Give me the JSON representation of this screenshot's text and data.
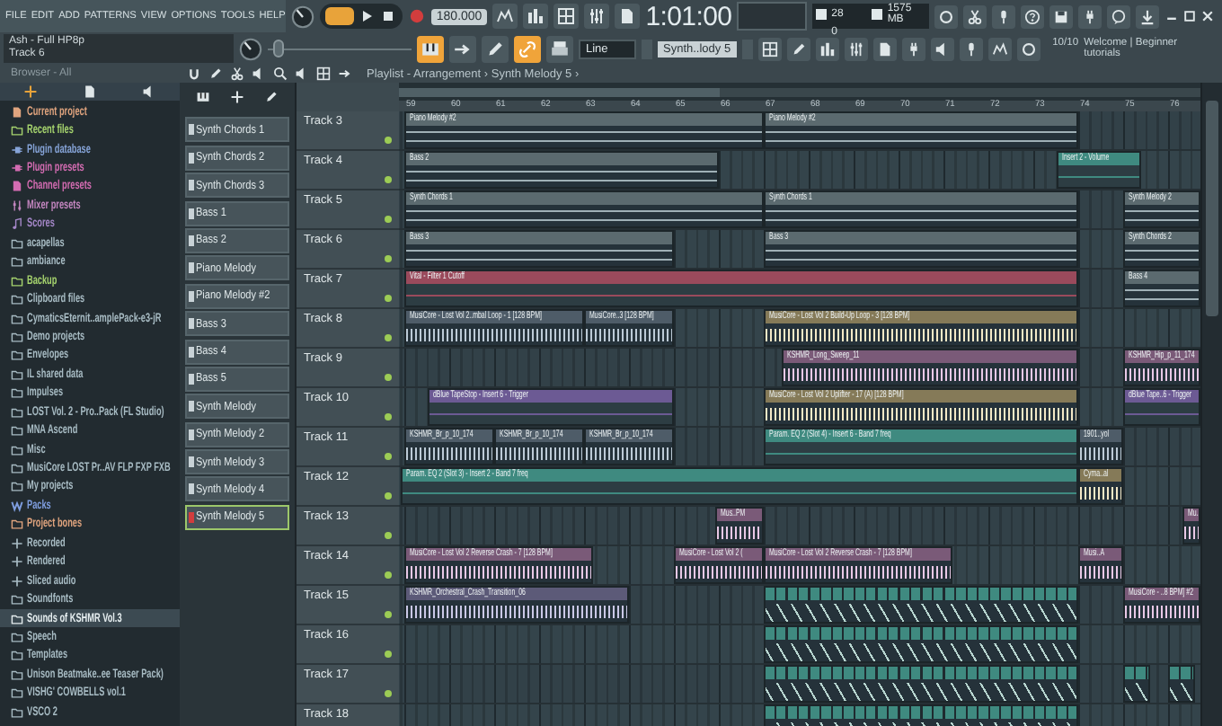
{
  "menu": [
    "FILE",
    "EDIT",
    "ADD",
    "PATTERNS",
    "VIEW",
    "OPTIONS",
    "TOOLS",
    "HELP"
  ],
  "hint": {
    "title": "Ash - Full HP8p",
    "subtitle": "Track 6"
  },
  "transport": {
    "song_mode": true,
    "tempo": "180.000"
  },
  "time": "1:01:00",
  "monitor": {
    "cpu": "28",
    "memory": "1575 MB",
    "polyphony": "0"
  },
  "master_pitch": {
    "level": 0.08
  },
  "snap_tools": [
    {
      "on": true
    },
    {
      "on": false
    },
    {
      "on": false
    },
    {
      "on": true
    },
    {
      "on": false
    }
  ],
  "snap": "Line",
  "pattern_selector": "Synth..lody 5",
  "news": {
    "count": "10/10",
    "text": "Welcome | Beginner tutorials"
  },
  "browser": {
    "title": "Browser - All",
    "items": [
      {
        "label": "Current project",
        "kind": "project",
        "color": "#e0a47e",
        "selected": false
      },
      {
        "label": "Recent files",
        "kind": "folder",
        "color": "#a6d46e",
        "selected": false
      },
      {
        "label": "Plugin database",
        "kind": "plugin",
        "color": "#86a4d8",
        "selected": false
      },
      {
        "label": "Plugin presets",
        "kind": "plugin",
        "color": "#d46cb2",
        "selected": false
      },
      {
        "label": "Channel presets",
        "kind": "project",
        "color": "#d46cb2",
        "selected": false
      },
      {
        "label": "Mixer presets",
        "kind": "mixer",
        "color": "#c486c0",
        "selected": false
      },
      {
        "label": "Scores",
        "kind": "note",
        "color": "#a487c8",
        "selected": false
      },
      {
        "label": "acapellas",
        "kind": "folder",
        "color": "#a8bcc4",
        "selected": false
      },
      {
        "label": "ambiance",
        "kind": "folder",
        "color": "#a8bcc4",
        "selected": false
      },
      {
        "label": "Backup",
        "kind": "folder",
        "color": "#a6d46e",
        "selected": false
      },
      {
        "label": "Clipboard files",
        "kind": "folder",
        "color": "#a8bcc4",
        "selected": false
      },
      {
        "label": "CymaticsEternit..amplePack-e3-jR",
        "kind": "folder",
        "color": "#a8bcc4",
        "selected": false
      },
      {
        "label": "Demo projects",
        "kind": "folder",
        "color": "#a8bcc4",
        "selected": false
      },
      {
        "label": "Envelopes",
        "kind": "folder",
        "color": "#a8bcc4",
        "selected": false
      },
      {
        "label": "IL shared data",
        "kind": "folder",
        "color": "#a8bcc4",
        "selected": false
      },
      {
        "label": "Impulses",
        "kind": "folder",
        "color": "#a8bcc4",
        "selected": false
      },
      {
        "label": "LOST Vol. 2 - Pro..Pack (FL Studio)",
        "kind": "folder",
        "color": "#a8bcc4",
        "selected": false
      },
      {
        "label": "MNA Ascend",
        "kind": "folder",
        "color": "#a8bcc4",
        "selected": false
      },
      {
        "label": "Misc",
        "kind": "folder",
        "color": "#a8bcc4",
        "selected": false
      },
      {
        "label": "MusiCore LOST Pr..AV FLP FXP FXB",
        "kind": "folder",
        "color": "#a8bcc4",
        "selected": false
      },
      {
        "label": "My projects",
        "kind": "folder",
        "color": "#a8bcc4",
        "selected": false
      },
      {
        "label": "Packs",
        "kind": "packs",
        "color": "#7f9ee0",
        "selected": false
      },
      {
        "label": "Project bones",
        "kind": "folder",
        "color": "#e0a47e",
        "selected": false
      },
      {
        "label": "Recorded",
        "kind": "plus",
        "color": "#a8bcc4",
        "selected": false
      },
      {
        "label": "Rendered",
        "kind": "plus",
        "color": "#a8bcc4",
        "selected": false
      },
      {
        "label": "Sliced audio",
        "kind": "plus",
        "color": "#a8bcc4",
        "selected": false
      },
      {
        "label": "Soundfonts",
        "kind": "folder",
        "color": "#a8bcc4",
        "selected": false
      },
      {
        "label": "Sounds of KSHMR Vol.3",
        "kind": "folder",
        "color": "#e6eef0",
        "selected": true
      },
      {
        "label": "Speech",
        "kind": "folder",
        "color": "#a8bcc4",
        "selected": false
      },
      {
        "label": "Templates",
        "kind": "folder",
        "color": "#a8bcc4",
        "selected": false
      },
      {
        "label": "Unison Beatmake..ee Teaser Pack)",
        "kind": "folder",
        "color": "#a8bcc4",
        "selected": false
      },
      {
        "label": "VISHG' COWBELLS vol.1",
        "kind": "folder",
        "color": "#a8bcc4",
        "selected": false
      },
      {
        "label": "VSCO 2",
        "kind": "folder",
        "color": "#a8bcc4",
        "selected": false
      }
    ]
  },
  "playlist": {
    "title": "Playlist - Arrangement › Synth Melody 5 ›",
    "patterns": [
      {
        "name": "Synth Chords 1",
        "selected": false
      },
      {
        "name": "Synth Chords 2",
        "selected": false
      },
      {
        "name": "Synth Chords 3",
        "selected": false
      },
      {
        "name": "Bass 1",
        "selected": false
      },
      {
        "name": "Bass 2",
        "selected": false
      },
      {
        "name": "Piano Melody",
        "selected": false
      },
      {
        "name": "Piano Melody #2",
        "selected": false
      },
      {
        "name": "Bass 3",
        "selected": false
      },
      {
        "name": "Bass 4",
        "selected": false
      },
      {
        "name": "Bass 5",
        "selected": false
      },
      {
        "name": "Synth Melody",
        "selected": false
      },
      {
        "name": "Synth Melody 2",
        "selected": false
      },
      {
        "name": "Synth Melody 3",
        "selected": false
      },
      {
        "name": "Synth Melody 4",
        "selected": false
      },
      {
        "name": "Synth Melody 5",
        "selected": true
      }
    ],
    "ruler": [
      "59",
      "60",
      "61",
      "62",
      "63",
      "64",
      "65",
      "66",
      "67",
      "68",
      "69",
      "70",
      "71",
      "72",
      "73",
      "74",
      "75",
      "76"
    ],
    "tracks": [
      {
        "name": "Track 3",
        "clips": [
          {
            "kind": "pattern",
            "name": "Piano Melody #2"
          },
          {
            "kind": "pattern",
            "name": "Piano Melody #2"
          }
        ]
      },
      {
        "name": "Track 4",
        "clips": [
          {
            "kind": "pattern",
            "name": "Bass 2"
          },
          {
            "kind": "automation",
            "name": "Insert 2 - Volume",
            "color": "#3f8a80"
          }
        ]
      },
      {
        "name": "Track 5",
        "clips": [
          {
            "kind": "pattern",
            "name": "Synth Chords 1"
          },
          {
            "kind": "pattern",
            "name": "Synth Chords 1"
          },
          {
            "kind": "pattern",
            "name": "Synth Melody 2"
          }
        ]
      },
      {
        "name": "Track 6",
        "clips": [
          {
            "kind": "pattern",
            "name": "Bass 3"
          },
          {
            "kind": "pattern",
            "name": "Bass 3"
          },
          {
            "kind": "pattern",
            "name": "Synth Chords 2"
          }
        ]
      },
      {
        "name": "Track 7",
        "clips": [
          {
            "kind": "automation",
            "name": "Vital - Filter 1 Cutoff",
            "color": "#9a4a5c"
          },
          {
            "kind": "pattern",
            "name": "Bass 4"
          }
        ]
      },
      {
        "name": "Track 8",
        "clips": [
          {
            "kind": "audio",
            "name": "MusiCore - Lost Vol 2..mbal Loop - 1 [128 BPM]",
            "color": "#4e5c68"
          },
          {
            "kind": "audio",
            "name": "MusiCore..3 [128 BPM]",
            "color": "#4e5c68"
          },
          {
            "kind": "audio",
            "name": "MusiCore - Lost Vol 2 Build-Up Loop - 3 [128 BPM]",
            "color": "#857a58"
          }
        ]
      },
      {
        "name": "Track 9",
        "clips": [
          {
            "kind": "audio",
            "name": "KSHMR_Long_Sweep_11",
            "color": "#7a5a78"
          },
          {
            "kind": "audio",
            "name": "KSHMR_Hip_p_11_174",
            "color": "#7a5a78"
          }
        ]
      },
      {
        "name": "Track 10",
        "clips": [
          {
            "kind": "automation",
            "name": "dBlue TapeStop - Insert 6 - Trigger",
            "color": "#6c5a94"
          },
          {
            "kind": "audio",
            "name": "MusiCore - Lost Vol 2 Uplifter - 17 (A) [128 BPM]",
            "color": "#857a58"
          },
          {
            "kind": "automation",
            "name": "dBlue Tape..6 - Trigger",
            "color": "#6c5a94"
          }
        ]
      },
      {
        "name": "Track 11",
        "clips": [
          {
            "kind": "audio",
            "name": "KSHMR_Br_p_10_174",
            "color": "#4e5c68"
          },
          {
            "kind": "audio",
            "name": "KSHMR_Br_p_10_174",
            "color": "#4e5c68"
          },
          {
            "kind": "audio",
            "name": "KSHMR_Br_p_10_174",
            "color": "#4e5c68"
          },
          {
            "kind": "automation",
            "name": "Param. EQ 2 (Slot 4) - Insert 6 - Band 7 freq",
            "color": "#3f8a80"
          },
          {
            "kind": "audio",
            "name": "1901..yol",
            "color": "#4e5c68"
          }
        ]
      },
      {
        "name": "Track 12",
        "clips": [
          {
            "kind": "automation",
            "name": "Param. EQ 2 (Slot 3) - Insert 2 - Band 7 freq",
            "color": "#3f8a80"
          },
          {
            "kind": "audio",
            "name": "Cyma..al",
            "color": "#857a58"
          }
        ]
      },
      {
        "name": "Track 13",
        "clips": [
          {
            "kind": "audio",
            "name": "Mus..PM",
            "color": "#7a5a78"
          },
          {
            "kind": "audio",
            "name": "Mu..",
            "color": "#7a5a78"
          }
        ]
      },
      {
        "name": "Track 14",
        "clips": [
          {
            "kind": "audio",
            "name": "MusiCore - Lost Vol 2 Reverse Crash - 7 [128 BPM]",
            "color": "#7a5a78"
          },
          {
            "kind": "audio",
            "name": "MusiCore - Lost Vol 2 (",
            "color": "#7a5a78"
          },
          {
            "kind": "audio",
            "name": "MusiCore - Lost Vol 2 Reverse Crash - 7 [128 BPM]",
            "color": "#7a5a78"
          },
          {
            "kind": "audio",
            "name": "Musi..A",
            "color": "#7a5a78"
          }
        ]
      },
      {
        "name": "Track 15",
        "clips": [
          {
            "kind": "audio",
            "name": "KSHMR_Orchestral_Crash_Transition_06",
            "color": "#5c5a78"
          },
          {
            "kind": "strip",
            "color": "#3f8a80"
          },
          {
            "kind": "audio",
            "name": "MusiCore - ..8 BPM] #2",
            "color": "#7a5a78"
          }
        ]
      },
      {
        "name": "Track 16",
        "clips": [
          {
            "kind": "strip",
            "color": "#3f8a80"
          }
        ]
      },
      {
        "name": "Track 17",
        "clips": [
          {
            "kind": "strip",
            "color": "#3f8a80"
          },
          {
            "kind": "strip",
            "color": "#3f8a80"
          },
          {
            "kind": "strip",
            "color": "#3f8a80"
          }
        ]
      },
      {
        "name": "Track 18",
        "clips": [
          {
            "kind": "strip",
            "color": "#3f8a80"
          }
        ]
      }
    ]
  }
}
